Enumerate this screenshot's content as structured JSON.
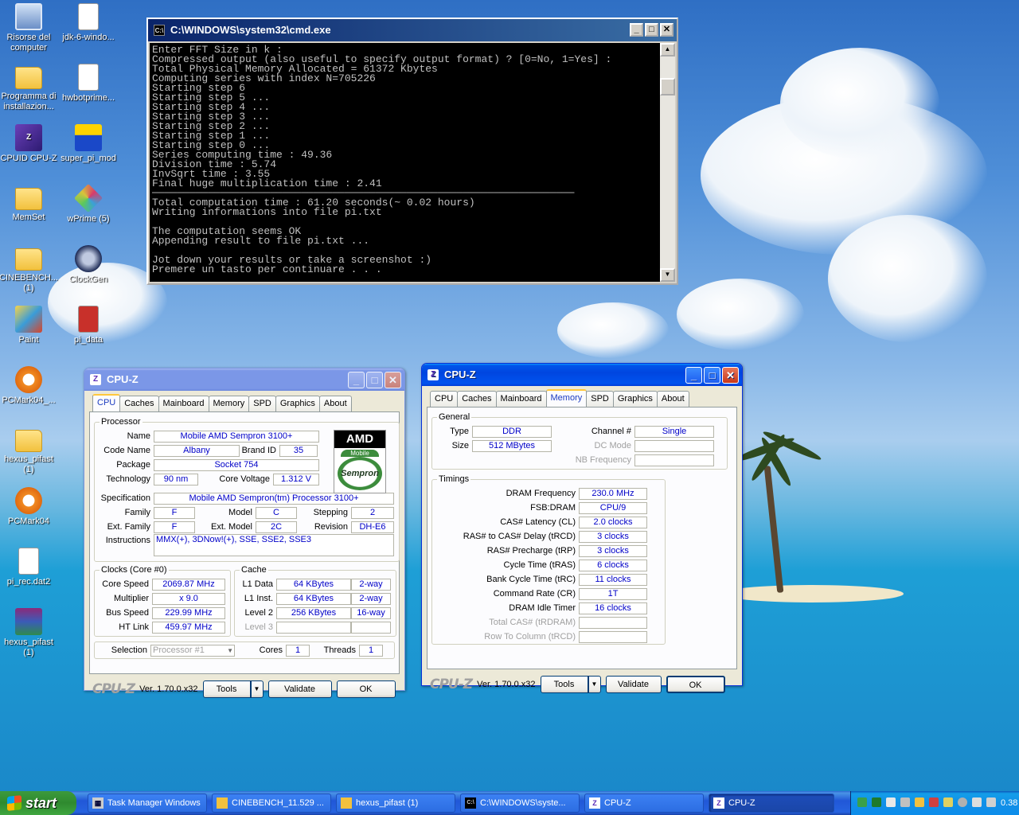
{
  "desktop_icons": [
    {
      "label": "Risorse del computer",
      "icon": "computer-icon"
    },
    {
      "label": "jdk-6-windo...",
      "icon": "java-installer-icon"
    },
    {
      "label": "Programma di installazion...",
      "icon": "folder-icon"
    },
    {
      "label": "hwbotprime...",
      "icon": "java-file-icon"
    },
    {
      "label": "CPUID CPU-Z",
      "icon": "cpuz-icon"
    },
    {
      "label": "super_pi_mod",
      "icon": "superpi-icon"
    },
    {
      "label": "MemSet",
      "icon": "folder-icon"
    },
    {
      "label": "wPrime (5)",
      "icon": "wprime-icon"
    },
    {
      "label": "CINEBENCH... (1)",
      "icon": "folder-icon"
    },
    {
      "label": "ClockGen",
      "icon": "clockgen-icon"
    },
    {
      "label": "Paint",
      "icon": "paint-icon"
    },
    {
      "label": "pi_data",
      "icon": "text-file-icon"
    },
    {
      "label": "PCMark04_...",
      "icon": "pcmark-icon"
    },
    {
      "label": "hexus_pifast (1)",
      "icon": "folder-icon"
    },
    {
      "label": "PCMark04",
      "icon": "pcmark-icon"
    },
    {
      "label": "pi_rec.dat2",
      "icon": "file-icon"
    },
    {
      "label": "hexus_pifast (1)",
      "icon": "winrar-icon"
    }
  ],
  "cmd": {
    "title": "C:\\WINDOWS\\system32\\cmd.exe",
    "lines": [
      "Enter FFT Size in k :",
      "Compressed output (also useful to specify output format) ? [0=No, 1=Yes] :",
      "Total Physical Memory Allocated = 61372 Kbytes",
      "Computing series with index N=705226",
      "Starting step 6",
      "Starting step 5 ...",
      "Starting step 4 ...",
      "Starting step 3 ...",
      "Starting step 2 ...",
      "Starting step 1 ...",
      "Starting step 0 ...",
      "Series computing time : 49.36",
      "Division time : 5.74",
      "InvSqrt time : 3.55",
      "Final huge multiplication time : 2.41",
      "────────────────────────────────────────────────────────────────────",
      "Total computation time : 61.20 seconds(~ 0.02 hours)",
      "Writing informations into file pi.txt",
      "",
      "The computation seems OK",
      "Appending result to file pi.txt ...",
      "",
      "Jot down your results or take a screenshot :)",
      "Premere un tasto per continuare . . ."
    ]
  },
  "cpuz_cpu": {
    "title": "CPU-Z",
    "tabs": [
      "CPU",
      "Caches",
      "Mainboard",
      "Memory",
      "SPD",
      "Graphics",
      "About"
    ],
    "processor_legend": "Processor",
    "name_label": "Name",
    "name": "Mobile AMD Sempron 3100+",
    "codename_label": "Code Name",
    "codename": "Albany",
    "brandid_label": "Brand ID",
    "brandid": "35",
    "package_label": "Package",
    "package": "Socket 754",
    "technology_label": "Technology",
    "technology": "90 nm",
    "corevoltage_label": "Core Voltage",
    "corevoltage": "1.312 V",
    "spec_label": "Specification",
    "spec": "Mobile AMD Sempron(tm) Processor 3100+",
    "family_label": "Family",
    "family": "F",
    "model_label": "Model",
    "model": "C",
    "stepping_label": "Stepping",
    "stepping": "2",
    "extfamily_label": "Ext. Family",
    "extfamily": "F",
    "extmodel_label": "Ext. Model",
    "extmodel": "2C",
    "revision_label": "Revision",
    "revision": "DH-E6",
    "instructions_label": "Instructions",
    "instructions": "MMX(+), 3DNow!(+), SSE, SSE2, SSE3",
    "logo_amd": "AMD",
    "logo_mobile": "Mobile",
    "logo_sempron": "Sempron",
    "clocks_legend": "Clocks (Core #0)",
    "corespeed_label": "Core Speed",
    "corespeed": "2069.87 MHz",
    "multiplier_label": "Multiplier",
    "multiplier": "x 9.0",
    "busspeed_label": "Bus Speed",
    "busspeed": "229.99 MHz",
    "htlink_label": "HT Link",
    "htlink": "459.97 MHz",
    "cache_legend": "Cache",
    "l1data_label": "L1 Data",
    "l1data": "64 KBytes",
    "l1data_way": "2-way",
    "l1inst_label": "L1 Inst.",
    "l1inst": "64 KBytes",
    "l1inst_way": "2-way",
    "l2_label": "Level 2",
    "l2": "256 KBytes",
    "l2_way": "16-way",
    "l3_label": "Level 3",
    "selection_label": "Selection",
    "selection": "Processor #1",
    "cores_label": "Cores",
    "cores": "1",
    "threads_label": "Threads",
    "threads": "1",
    "brand": "CPU-Z",
    "version": "Ver. 1.70.0.x32",
    "tools": "Tools",
    "validate": "Validate",
    "ok": "OK"
  },
  "cpuz_mem": {
    "title": "CPU-Z",
    "tabs": [
      "CPU",
      "Caches",
      "Mainboard",
      "Memory",
      "SPD",
      "Graphics",
      "About"
    ],
    "general_legend": "General",
    "type_label": "Type",
    "type": "DDR",
    "size_label": "Size",
    "size": "512 MBytes",
    "channel_label": "Channel #",
    "channel": "Single",
    "dcmode_label": "DC Mode",
    "nbfreq_label": "NB Frequency",
    "timings_legend": "Timings",
    "timings": [
      {
        "label": "DRAM Frequency",
        "value": "230.0 MHz",
        "dim": false
      },
      {
        "label": "FSB:DRAM",
        "value": "CPU/9",
        "dim": false
      },
      {
        "label": "CAS# Latency (CL)",
        "value": "2.0 clocks",
        "dim": false
      },
      {
        "label": "RAS# to CAS# Delay (tRCD)",
        "value": "3 clocks",
        "dim": false
      },
      {
        "label": "RAS# Precharge (tRP)",
        "value": "3 clocks",
        "dim": false
      },
      {
        "label": "Cycle Time (tRAS)",
        "value": "6 clocks",
        "dim": false
      },
      {
        "label": "Bank Cycle Time (tRC)",
        "value": "11 clocks",
        "dim": false
      },
      {
        "label": "Command Rate (CR)",
        "value": "1T",
        "dim": false
      },
      {
        "label": "DRAM Idle Timer",
        "value": "16 clocks",
        "dim": false
      },
      {
        "label": "Total CAS# (tRDRAM)",
        "value": "",
        "dim": true
      },
      {
        "label": "Row To Column (tRCD)",
        "value": "",
        "dim": true
      }
    ],
    "brand": "CPU-Z",
    "version": "Ver. 1.70.0.x32",
    "tools": "Tools",
    "validate": "Validate",
    "ok": "OK"
  },
  "taskbar": {
    "start": "start",
    "items": [
      {
        "label": "Task Manager Windows",
        "icon": "task-manager-icon"
      },
      {
        "label": "CINEBENCH_11.529 ...",
        "icon": "folder-icon"
      },
      {
        "label": "hexus_pifast (1)",
        "icon": "folder-icon"
      },
      {
        "label": "C:\\WINDOWS\\syste...",
        "icon": "cmd-icon"
      },
      {
        "label": "CPU-Z",
        "icon": "cpuz-icon"
      },
      {
        "label": "CPU-Z",
        "icon": "cpuz-icon"
      }
    ],
    "clock": "0.38"
  }
}
